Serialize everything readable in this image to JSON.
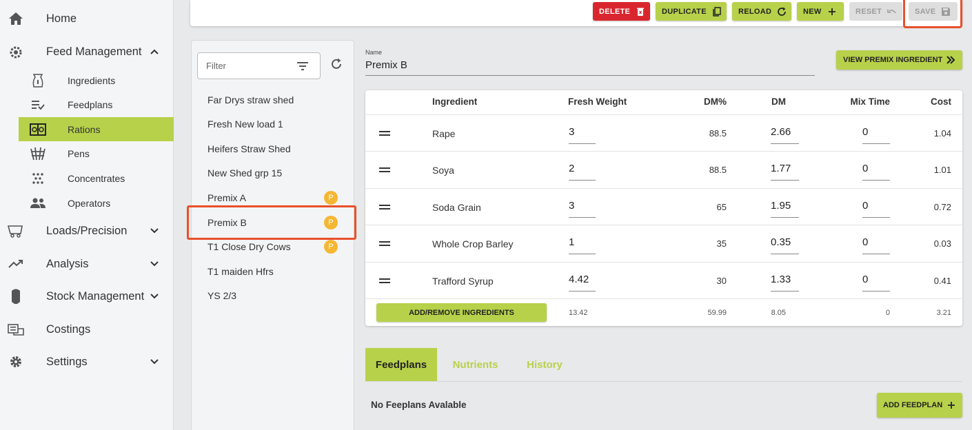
{
  "sidebar": {
    "home": "Home",
    "feed_management": "Feed Management",
    "sub": {
      "ingredients": "Ingredients",
      "feedplans": "Feedplans",
      "rations": "Rations",
      "pens": "Pens",
      "concentrates": "Concentrates",
      "operators": "Operators"
    },
    "loads": "Loads/Precision",
    "analysis": "Analysis",
    "stock": "Stock Management",
    "costings": "Costings",
    "settings": "Settings"
  },
  "toolbar": {
    "delete": "DELETE",
    "duplicate": "DUPLICATE",
    "reload": "RELOAD",
    "new": "NEW",
    "reset": "RESET",
    "save": "SAVE"
  },
  "list": {
    "filter_placeholder": "Filter",
    "items": [
      {
        "name": "Far Drys straw shed",
        "badge": ""
      },
      {
        "name": "Fresh New load 1",
        "badge": ""
      },
      {
        "name": "Heifers Straw Shed",
        "badge": ""
      },
      {
        "name": "New Shed grp 15",
        "badge": ""
      },
      {
        "name": "Premix A",
        "badge": "P"
      },
      {
        "name": "Premix B",
        "badge": "P"
      },
      {
        "name": "T1 Close Dry Cows",
        "badge": "P"
      },
      {
        "name": "T1 maiden Hfrs",
        "badge": ""
      },
      {
        "name": "YS 2/3",
        "badge": ""
      }
    ]
  },
  "ration": {
    "name_label": "Name",
    "name_value": "Premix B",
    "view_premix_label": "VIEW PREMIX INGREDIENT"
  },
  "table": {
    "headers": {
      "ingredient": "Ingredient",
      "fresh_weight": "Fresh Weight",
      "dm_pct": "DM%",
      "dm": "DM",
      "mix_time": "Mix Time",
      "cost": "Cost"
    },
    "rows": [
      {
        "ingredient": "Rape",
        "fresh_weight": "3",
        "dm_pct": "88.5",
        "dm": "2.66",
        "mix_time": "0",
        "cost": "1.04"
      },
      {
        "ingredient": "Soya",
        "fresh_weight": "2",
        "dm_pct": "88.5",
        "dm": "1.77",
        "mix_time": "0",
        "cost": "1.01"
      },
      {
        "ingredient": "Soda Grain",
        "fresh_weight": "3",
        "dm_pct": "65",
        "dm": "1.95",
        "mix_time": "0",
        "cost": "0.72"
      },
      {
        "ingredient": "Whole Crop Barley",
        "fresh_weight": "1",
        "dm_pct": "35",
        "dm": "0.35",
        "mix_time": "0",
        "cost": "0.03"
      },
      {
        "ingredient": "Trafford Syrup",
        "fresh_weight": "4.42",
        "dm_pct": "30",
        "dm": "1.33",
        "mix_time": "0",
        "cost": "0.41"
      }
    ],
    "totals": {
      "fresh_weight": "13.42",
      "dm_pct": "59.99",
      "dm": "8.05",
      "mix_time": "0",
      "cost": "3.21"
    },
    "add_remove_label": "ADD/REMOVE INGREDIENTS"
  },
  "tabs": {
    "feedplans": "Feedplans",
    "nutrients": "Nutrients",
    "history": "History"
  },
  "feedplans": {
    "empty_text": "No Feeplans Avalable",
    "add_label": "ADD FEEDPLAN"
  },
  "colors": {
    "accent": "#b7d14a",
    "danger": "#d9262e",
    "badge": "#f5b733",
    "highlight": "#e8502b"
  }
}
